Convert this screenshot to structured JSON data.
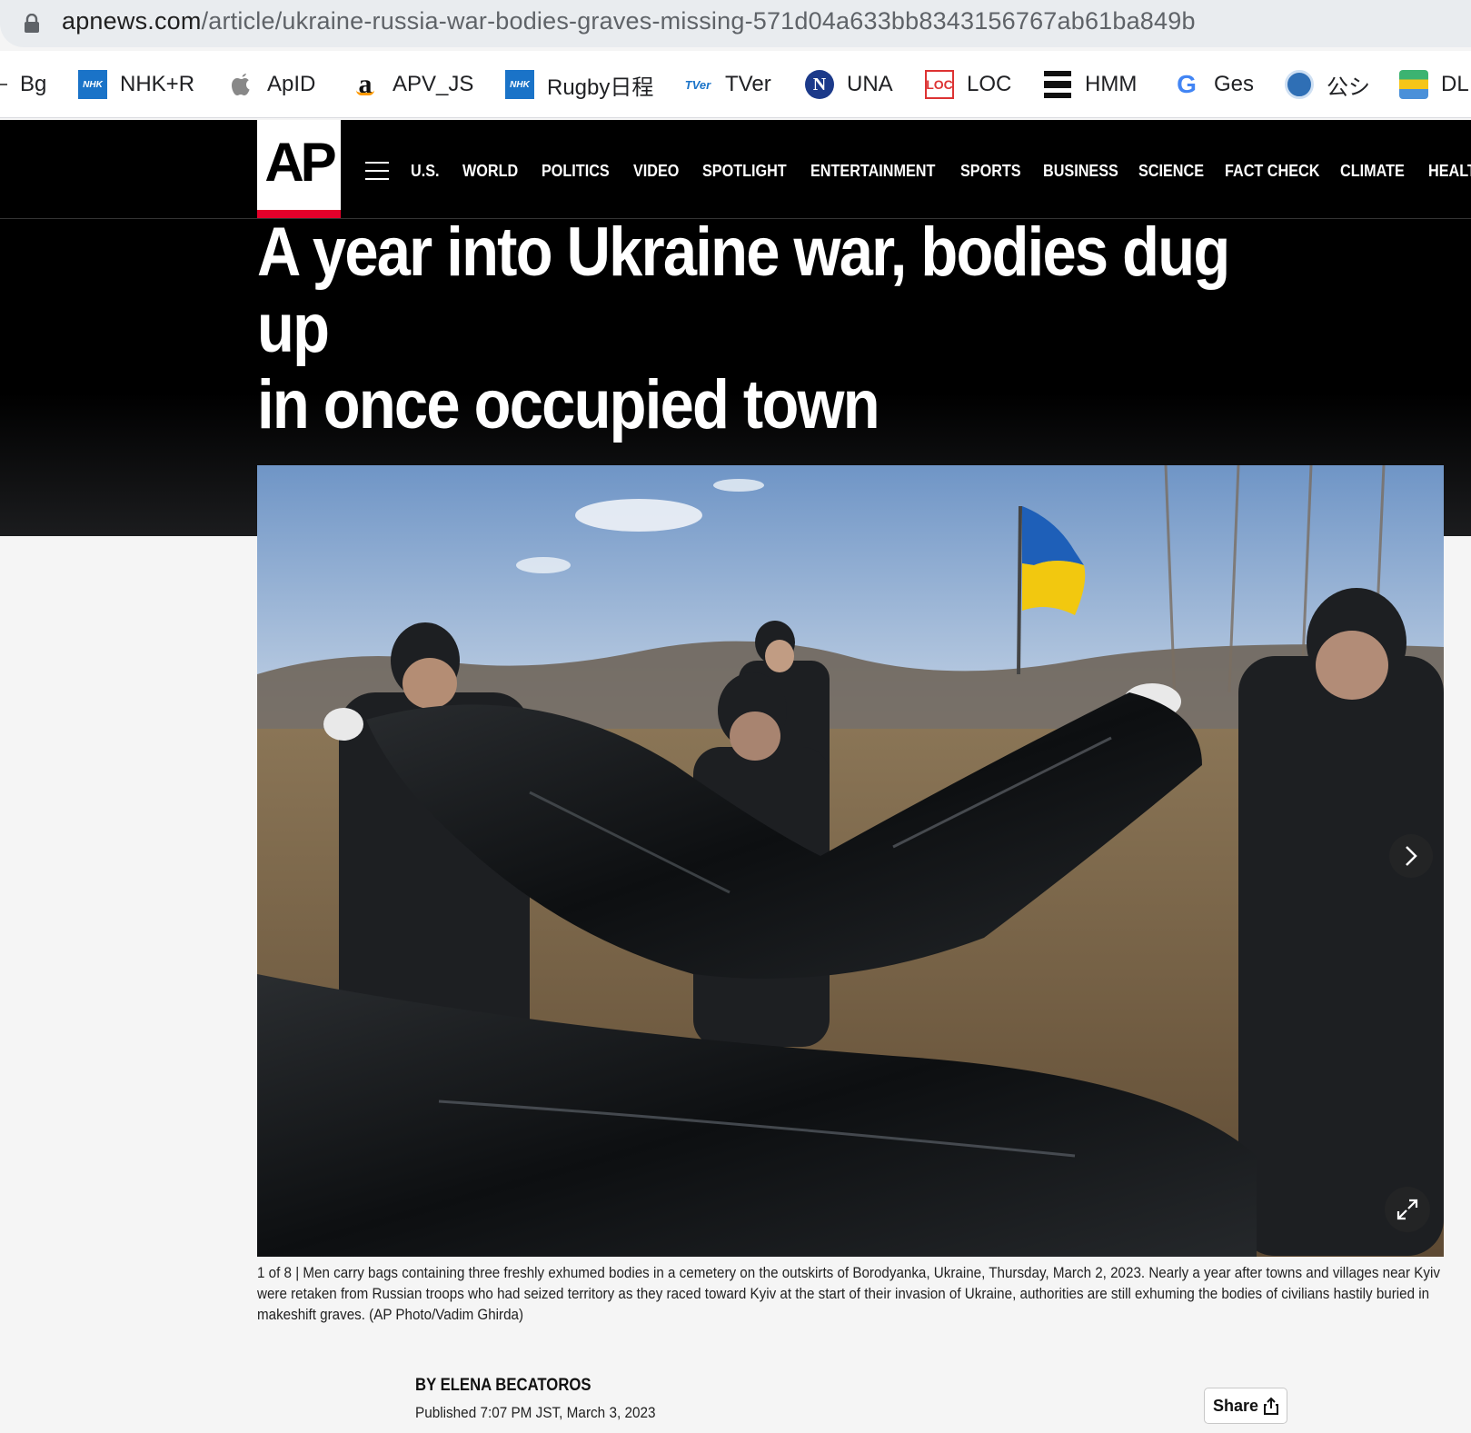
{
  "browser": {
    "url_host": "apnews.com",
    "url_path": "/article/ukraine-russia-war-bodies-graves-missing-571d04a633bb8343156767ab61ba849b"
  },
  "bookmarks": [
    {
      "label": "Bg",
      "icon": "bookmark-icon"
    },
    {
      "label": "NHK+R",
      "icon": "nhk-icon"
    },
    {
      "label": "ApID",
      "icon": "apple-icon"
    },
    {
      "label": "APV_JS",
      "icon": "amazon-icon"
    },
    {
      "label": "Rugby日程",
      "icon": "nhk-icon"
    },
    {
      "label": "TVer",
      "icon": "tver-icon"
    },
    {
      "label": "UNA",
      "icon": "una-icon"
    },
    {
      "label": "LOC",
      "icon": "loc-icon"
    },
    {
      "label": "HMM",
      "icon": "hmm-icon"
    },
    {
      "label": "Ges",
      "icon": "google-icon"
    },
    {
      "label": "公シ",
      "icon": "emblem-icon"
    },
    {
      "label": "DL",
      "icon": "dl-icon"
    }
  ],
  "header": {
    "logo": "AP",
    "nav": [
      "U.S.",
      "WORLD",
      "POLITICS",
      "VIDEO",
      "SPOTLIGHT",
      "ENTERTAINMENT",
      "SPORTS",
      "BUSINESS",
      "SCIENCE",
      "FACT CHECK",
      "CLIMATE",
      "HEALT"
    ]
  },
  "article": {
    "headline_line1": "A year into Ukraine war, bodies dug up",
    "headline_line2": "in once occupied town",
    "caption": "1 of 8 | Men carry bags containing three freshly exhumed bodies in a cemetery on the outskirts of Borodyanka, Ukraine, Thursday, March 2, 2023. Nearly a year after towns and villages near Kyiv were retaken from Russian troops who had seized territory as they raced toward Kyiv at the start of their invasion of Ukraine, authorities are still exhuming the bodies of civilians hastily buried in makeshift graves. (AP Photo/Vadim Ghirda)",
    "byline": "BY ELENA BECATOROS",
    "published": "Published 7:07 PM JST, March 3, 2023",
    "share_label": "Share"
  },
  "colors": {
    "ap_red": "#e4002b",
    "flag_blue": "#1e5fb8",
    "flag_yellow": "#f2c80f"
  }
}
